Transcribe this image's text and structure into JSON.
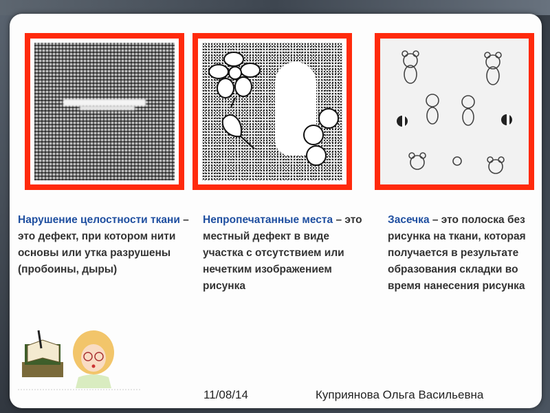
{
  "captions": [
    {
      "lead": "Нарушение целостности ткани",
      "rest": " – это дефект, при котором нити основы или утка разрушены (пробоины, дыры)"
    },
    {
      "lead": "Непропечатанные места",
      "rest": " – это местный дефект в виде участка с отсутствием или нечетким изображением рисунка"
    },
    {
      "lead": "Засечка",
      "rest": " – это полоска без рисунка на ткани, которая получается в результате образования складки во время нанесения рисунка"
    }
  ],
  "footer": {
    "date": "11/08/14",
    "author": "Куприянова Ольга Васильевна"
  },
  "colors": {
    "frame": "#ff2a0c",
    "lead_text": "#1f4fa0",
    "body_text": "#333333"
  }
}
